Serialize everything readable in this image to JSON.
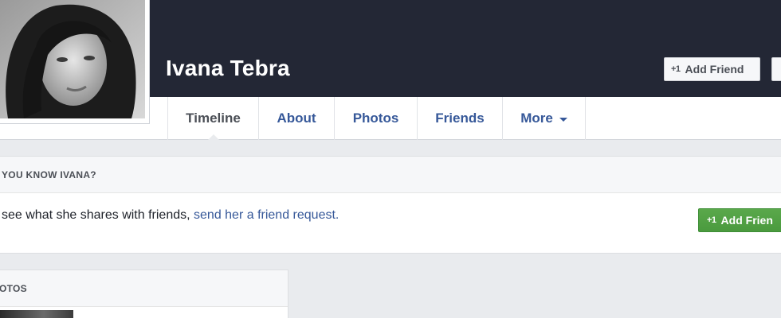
{
  "profile": {
    "name": "Ivana Tebra"
  },
  "header_buttons": {
    "add_friend_label": "Add Friend",
    "plus_icon_text": "+1"
  },
  "tabs": [
    {
      "label": "Timeline",
      "active": true
    },
    {
      "label": "About"
    },
    {
      "label": "Photos"
    },
    {
      "label": "Friends"
    },
    {
      "label": "More"
    }
  ],
  "know_box": {
    "header": "YOU KNOW IVANA?",
    "text_prefix": "see what she shares with friends,",
    "link_text": "send her a friend request.",
    "button_label": "Add Frien",
    "button_icon_text": "+1"
  },
  "photos_box": {
    "header": "OTOS"
  },
  "colors": {
    "cover": "#232735",
    "link": "#365899",
    "green_button": "#4a9a3e",
    "page_bg": "#e9ebee"
  }
}
